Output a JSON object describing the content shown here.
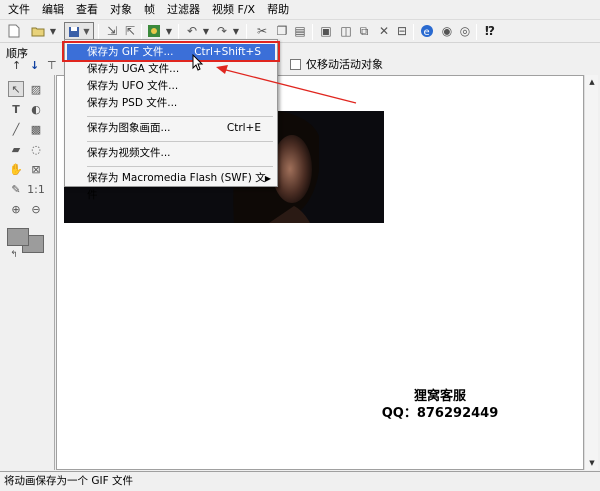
{
  "menubar": {
    "items": [
      "文件",
      "编辑",
      "查看",
      "对象",
      "帧",
      "过滤器",
      "视频 F/X",
      "帮助"
    ]
  },
  "toolbar": {
    "icons": [
      "new-icon",
      "open-icon",
      "save-icon",
      "import-icon",
      "export-icon",
      "preview-icon",
      "undo-icon",
      "redo-icon",
      "cut-icon",
      "copy-icon",
      "paste-icon",
      "delete-icon",
      "frame-icon",
      "browser-icon",
      "help-icon"
    ]
  },
  "order_panel": {
    "label": "顺序",
    "only_move_active_label": "仅移动活动对象"
  },
  "save_menu": {
    "items": [
      {
        "label": "保存为 GIF 文件...",
        "shortcut": "Ctrl+Shift+S"
      },
      {
        "label": "保存为 UGA 文件..."
      },
      {
        "label": "保存为 UFO 文件..."
      },
      {
        "label": "保存为 PSD 文件..."
      },
      {
        "label": "保存为图象画面...",
        "shortcut": "Ctrl+E"
      },
      {
        "label": "保存为视频文件..."
      },
      {
        "label": "保存为 Macromedia Flash (SWF) 文件"
      }
    ]
  },
  "watermark": {
    "line1": "狸窝客服",
    "line2": "QQ：876292449"
  },
  "statusbar": {
    "text": "将动画保存为一个 GIF 文件"
  },
  "colors": {
    "menu_highlight": "#3b6fd8",
    "annotation_red": "#e0261f"
  }
}
